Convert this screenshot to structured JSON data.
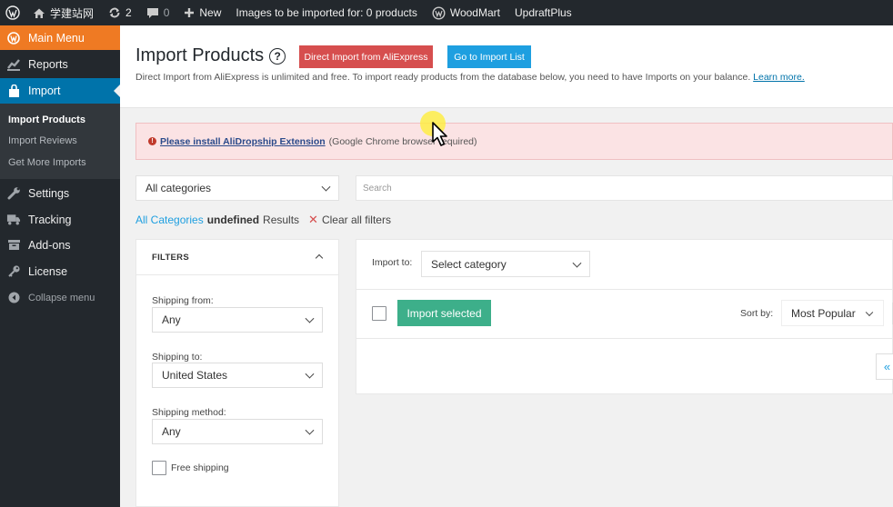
{
  "adminbar": {
    "site_name": "学建站网",
    "updates_count": "2",
    "comments_count": "0",
    "new_label": "New",
    "import_status": "Images to be imported for: 0 products",
    "woodmart_label": "WoodMart",
    "updraft_label": "UpdraftPlus"
  },
  "sidebar": {
    "main_menu": "Main Menu",
    "reports": "Reports",
    "import": "Import",
    "submenu": [
      "Import Products",
      "Import Reviews",
      "Get More Imports"
    ],
    "settings": "Settings",
    "tracking": "Tracking",
    "addons": "Add-ons",
    "license": "License",
    "collapse": "Collapse menu"
  },
  "header": {
    "title": "Import Products",
    "help": "?",
    "direct_import_btn": "Direct Import from AliExpress",
    "import_list_btn": "Go to Import List",
    "description": "Direct Import from AliExpress is unlimited and free. To import ready products from the database below, you need to have Imports on your balance.",
    "learn_more": "Learn more."
  },
  "notice": {
    "icon": "!",
    "link": "Please install AliDropship Extension",
    "text": "(Google Chrome browser required)"
  },
  "filters_bar": {
    "category": "All categories",
    "search_placeholder": "Search",
    "all_categories": "All Categories",
    "results_count": "undefined",
    "results_word": "Results",
    "clear_icon": "✕",
    "clear_all": "Clear all filters"
  },
  "filters": {
    "title": "FILTERS",
    "shipping_from_label": "Shipping from:",
    "shipping_from": "Any",
    "shipping_to_label": "Shipping to:",
    "shipping_to": "United States",
    "shipping_method_label": "Shipping method:",
    "shipping_method": "Any",
    "free_shipping": "Free shipping"
  },
  "panel": {
    "import_to_label": "Import to:",
    "import_to_value": "Select category",
    "import_selected": "Import selected",
    "sort_by_label": "Sort by:",
    "sort_by_value": "Most Popular",
    "pager_first": "«"
  }
}
